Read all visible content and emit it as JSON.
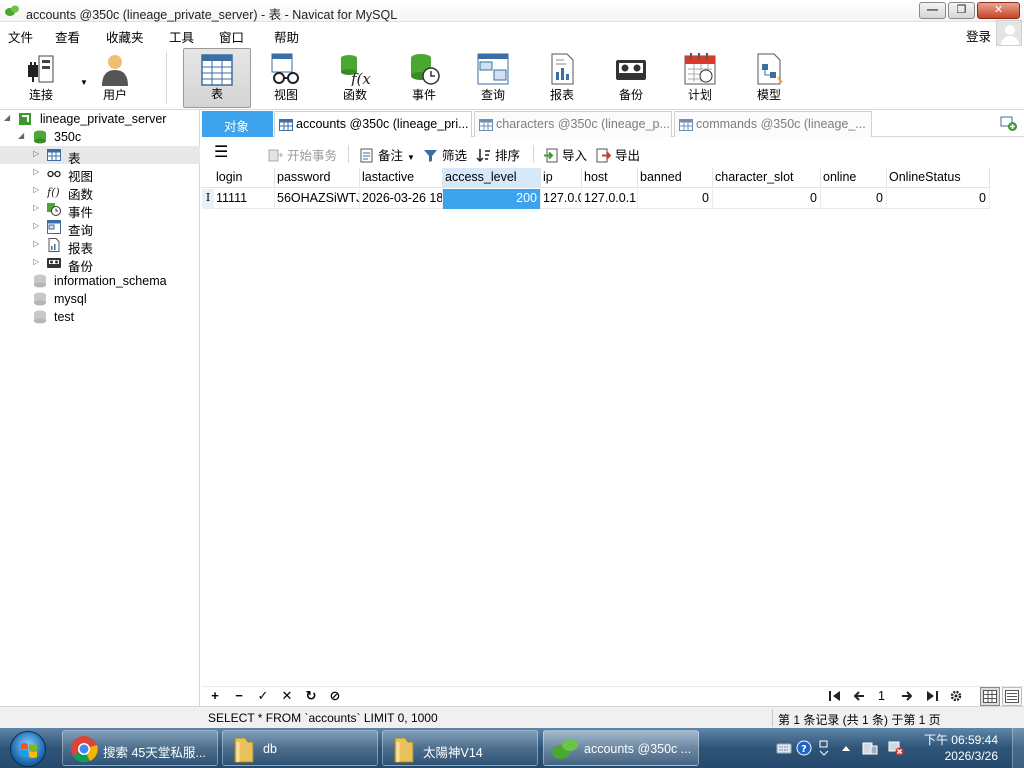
{
  "window": {
    "title": "accounts @350c (lineage_private_server) - 表 - Navicat for MySQL",
    "minimize_glyph": "—",
    "restore_glyph": "❐",
    "close_glyph": "✕"
  },
  "menubar": {
    "items": [
      "文件",
      "查看",
      "收藏夹",
      "工具",
      "窗口",
      "帮助"
    ],
    "login_label": "登录"
  },
  "toolbar": {
    "tools": [
      {
        "label": "连接",
        "icon": "plug-icon"
      },
      {
        "label": "用户",
        "icon": "user-icon"
      },
      {
        "label": "表",
        "icon": "table-icon",
        "active": true
      },
      {
        "label": "视图",
        "icon": "glasses-icon"
      },
      {
        "label": "函数",
        "icon": "function-icon"
      },
      {
        "label": "事件",
        "icon": "event-clock-icon"
      },
      {
        "label": "查询",
        "icon": "query-icon"
      },
      {
        "label": "报表",
        "icon": "report-icon"
      },
      {
        "label": "备份",
        "icon": "backup-tape-icon"
      },
      {
        "label": "计划",
        "icon": "calendar-icon"
      },
      {
        "label": "模型",
        "icon": "model-icon"
      }
    ]
  },
  "tree": {
    "connection": "lineage_private_server",
    "database": "350c",
    "objects": [
      "表",
      "视图",
      "函数",
      "事件",
      "查询",
      "报表",
      "备份"
    ],
    "other_databases": [
      "information_schema",
      "mysql",
      "test"
    ]
  },
  "tabs": {
    "objects_label": "对象",
    "documents": [
      {
        "label": "accounts @350c (lineage_pri...",
        "active": true
      },
      {
        "label": "characters @350c (lineage_p...",
        "active": false
      },
      {
        "label": "commands @350c (lineage_...",
        "active": false
      }
    ]
  },
  "subtoolbar": {
    "begin_transaction": "开始事务",
    "memo": "备注",
    "filter": "筛选",
    "sort": "排序",
    "import": "导入",
    "export": "导出"
  },
  "grid": {
    "columns": [
      "login",
      "password",
      "lastactive",
      "access_level",
      "ip",
      "host",
      "banned",
      "character_slot",
      "online",
      "OnlineStatus"
    ],
    "selected_column": "access_level",
    "row_marker": "I",
    "rows": [
      [
        "11111",
        "56OHAZSiWTJ",
        "2026-03-26 18",
        "200",
        "127.0.0.",
        "127.0.0.1",
        "0",
        "0",
        "0",
        "0"
      ]
    ]
  },
  "grid_bottom": {
    "add": "+",
    "remove": "−",
    "apply": "✓",
    "cancel": "✕",
    "refresh": "↻",
    "stop": "⊘",
    "page_number": "1"
  },
  "status": {
    "sql": "SELECT * FROM `accounts` LIMIT 0, 1000",
    "records": "第 1 条记录 (共 1 条) 于第 1 页"
  },
  "taskbar": {
    "tasks": [
      {
        "label": "搜索 45天堂私服...",
        "icon": "chrome-icon"
      },
      {
        "label": "db",
        "icon": "folder-icon"
      },
      {
        "label": "太陽神V14",
        "icon": "folder-icon"
      },
      {
        "label": "accounts @350c ...",
        "icon": "navicat-icon",
        "active": true
      }
    ],
    "clock_time": "下午 06:59:44",
    "clock_date": "2026/3/26"
  },
  "colors": {
    "accent_blue": "#3da3ec",
    "navicat_green": "#3a9a2a",
    "taskbar": "#2e5579"
  }
}
